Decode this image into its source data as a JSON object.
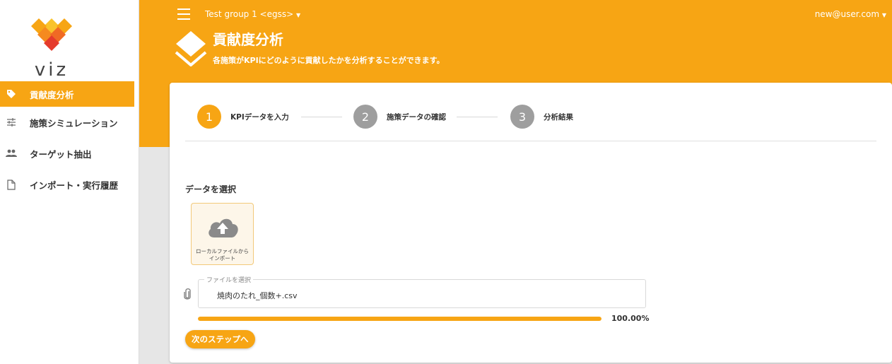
{
  "app": {
    "logo_text": "viz"
  },
  "header": {
    "group_select": "Test group 1 <egss>",
    "user": "new@user.com",
    "title": "貢献度分析",
    "subtitle": "各施策がKPIにどのように貢献したかを分析することができます。"
  },
  "sidebar": {
    "items": [
      {
        "label": "貢献度分析",
        "icon": "tag-icon",
        "active": true
      },
      {
        "label": "施策シミュレーション",
        "icon": "sliders-icon",
        "active": false
      },
      {
        "label": "ターゲット抽出",
        "icon": "people-icon",
        "active": false
      },
      {
        "label": "インポート・実行履歴",
        "icon": "document-icon",
        "active": false
      }
    ]
  },
  "stepper": {
    "steps": [
      {
        "number": "1",
        "label": "KPIデータを入力",
        "active": true
      },
      {
        "number": "2",
        "label": "施策データの確認",
        "active": false
      },
      {
        "number": "3",
        "label": "分析結果",
        "active": false
      }
    ]
  },
  "main": {
    "section_title": "データを選択",
    "upload_label": "ローカルファイルからインポート",
    "file_field_legend": "ファイルを選択",
    "file_name": "焼肉のたれ_個数+.csv",
    "progress_fraction": 1.0,
    "progress_text": "100.00%",
    "next_button": "次のステップへ"
  },
  "colors": {
    "accent": "#f7a514",
    "inactive_step": "#9e9e9e"
  }
}
